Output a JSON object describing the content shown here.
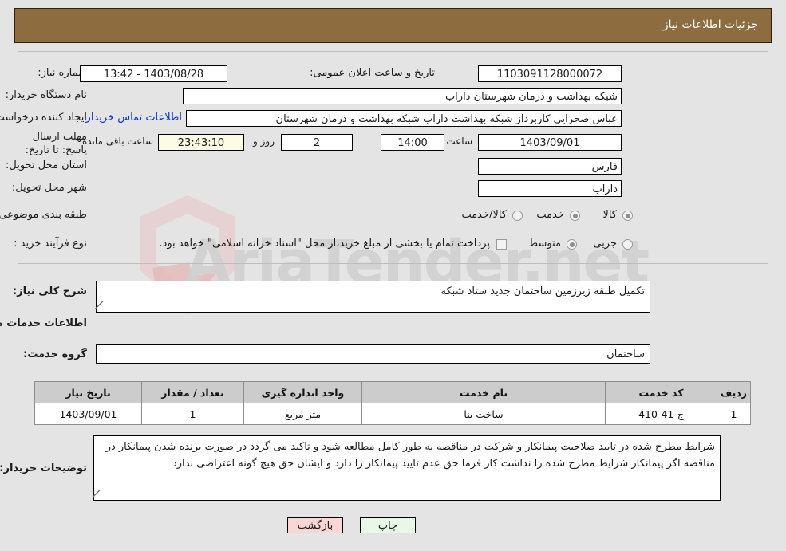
{
  "header": {
    "title": "جزئیات اطلاعات نیاز"
  },
  "form": {
    "need_number_label": "شماره نیاز:",
    "need_number_value": "1103091128000072",
    "announce_datetime_label": "تاریخ و ساعت اعلان عمومی:",
    "announce_datetime_value": "1403/08/28 - 13:42",
    "buyer_org_label": "نام دستگاه خریدار:",
    "buyer_org_value": "شبکه بهداشت و درمان شهرستان داراب",
    "creator_label": "ایجاد کننده درخواست:",
    "creator_value": "عباس صحرایی کاربرداز شبکه بهداشت داراب شبکه بهداشت و درمان شهرستان",
    "buyer_contact_link": "اطلاعات تماس خریدار",
    "deadline_label": "مهلت ارسال پاسخ: تا تاریخ:",
    "deadline_date": "1403/09/01",
    "deadline_hour_label": "ساعت",
    "deadline_hour_value": "14:00",
    "remaining_days": "2",
    "remaining_days_label": "روز و",
    "remaining_time": "23:43:10",
    "remaining_suffix_label": "ساعت باقی مانده",
    "province_label": "استان محل تحویل:",
    "province_value": "فارس",
    "city_label": "شهر محل تحویل:",
    "city_value": "داراب",
    "category_label": "طبقه بندی موضوعی:",
    "category_options": [
      {
        "label": "کالا",
        "selected": false
      },
      {
        "label": "خدمت",
        "selected": true
      },
      {
        "label": "کالا/خدمت",
        "selected": false
      }
    ],
    "process_type_label": "نوع فرآیند خرید :",
    "process_type_options": [
      {
        "label": "جزیی",
        "selected": false
      },
      {
        "label": "متوسط",
        "selected": true
      }
    ],
    "treasury_checkbox_label": "پرداخت تمام یا بخشی از مبلغ خرید،از محل \"اسناد خزانه اسلامی\" خواهد بود.",
    "treasury_checked": false
  },
  "description": {
    "general_need_label": "شرح کلی نیاز:",
    "general_need_value": "تکمیل طبقه زیرزمین ساختمان جدید ستاد شبکه",
    "services_section_title": "اطلاعات خدمات مورد نیاز",
    "service_group_label": "گروه خدمت:",
    "service_group_value": "ساختمان"
  },
  "table": {
    "columns": [
      "ردیف",
      "کد خدمت",
      "نام خدمت",
      "واحد اندازه گیری",
      "تعداد / مقدار",
      "تاریخ نیاز"
    ],
    "rows": [
      {
        "row": "1",
        "service_code": "ج-41-410",
        "service_name": "ساخت بنا",
        "unit": "متر مربع",
        "quantity": "1",
        "need_date": "1403/09/01"
      }
    ]
  },
  "notes": {
    "buyer_notes_label": "توضیحات خریدار:",
    "buyer_notes_value": "شرایط مطرح شده در تایید صلاحیت پیمانکار و شرکت در مناقصه به طور کامل مطالعه شود و تاکید می گردد در صورت برنده شدن پیمانکار در مناقصه اگر پیمانکار شرایط مطرح شده را نداشت کار فرما حق عدم تایید پیمانکار را دارد و ایشان حق هیچ گونه اعتراضی ندارد"
  },
  "footer": {
    "print_label": "چاپ",
    "back_label": "بازگشت"
  },
  "watermark": {
    "text": "AriaTender.net"
  },
  "colors": {
    "header_brown": "#8d6d3f",
    "link_blue": "#0a33c8",
    "print_green": "#e8f7e8",
    "back_pink": "#fcd6d6",
    "countdown_cream": "#fcfbe3",
    "table_header_gray": "#cccccc"
  }
}
